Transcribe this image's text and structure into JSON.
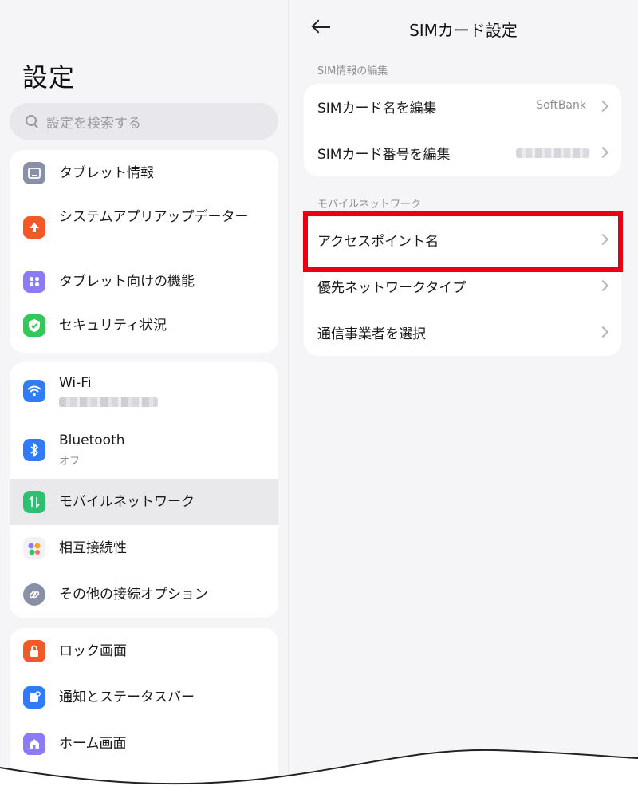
{
  "left": {
    "title": "設定",
    "search_placeholder": "設定を検索する",
    "group1": [
      {
        "label": "タブレット情報",
        "icon": "tablet-icon",
        "color": "#8a8fa8"
      },
      {
        "label": "システムアプリアップデーター",
        "icon": "arrow-up-icon",
        "color": "#f05a28"
      },
      {
        "label": "タブレット向けの機能",
        "icon": "grid-icon",
        "color": "#8b7cf6"
      },
      {
        "label": "セキュリティ状況",
        "icon": "shield-check-icon",
        "color": "#34c759"
      }
    ],
    "group2": [
      {
        "label": "Wi-Fi",
        "icon": "wifi-icon",
        "color": "#2f7cf6"
      },
      {
        "label": "Bluetooth",
        "sub": "オフ",
        "icon": "bluetooth-icon",
        "color": "#2f7cf6"
      },
      {
        "label": "モバイルネットワーク",
        "icon": "mobile-data-icon",
        "color": "#2fbf71"
      },
      {
        "label": "相互接続性",
        "icon": "dots-icon",
        "color": "#f2f2f5"
      },
      {
        "label": "その他の接続オプション",
        "icon": "link-icon",
        "color": "#8a8fa8"
      }
    ],
    "group3": [
      {
        "label": "ロック画面",
        "icon": "lock-icon",
        "color": "#f05a28"
      },
      {
        "label": "通知とステータスバー",
        "icon": "notification-icon",
        "color": "#2f7cf6"
      },
      {
        "label": "ホーム画面",
        "icon": "home-icon",
        "color": "#8b7cf6"
      }
    ]
  },
  "right": {
    "title": "SIMカード設定",
    "section1": "SIM情報の編集",
    "rows1": [
      {
        "label": "SIMカード名を編集",
        "value": "SoftBank"
      },
      {
        "label": "SIMカード番号を編集"
      }
    ],
    "section2": "モバイルネットワーク",
    "rows2": [
      {
        "label": "アクセスポイント名"
      },
      {
        "label": "優先ネットワークタイプ"
      },
      {
        "label": "通信事業者を選択"
      }
    ],
    "highlight_color": "#e60012"
  }
}
